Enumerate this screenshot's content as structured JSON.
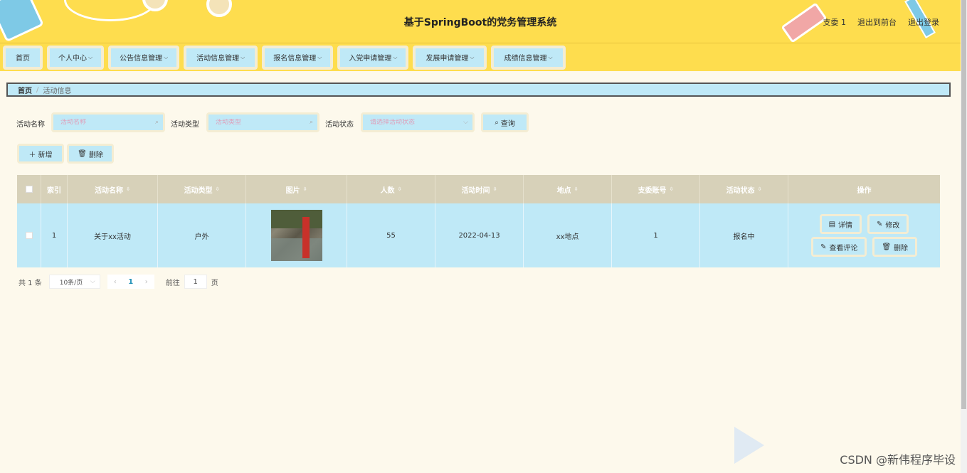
{
  "header": {
    "title": "基于SpringBoot的党务管理系统",
    "user": "支委 1",
    "exit_front": "退出到前台",
    "logout": "退出登录"
  },
  "nav": {
    "items": [
      {
        "label": "首页",
        "has_dropdown": false
      },
      {
        "label": "个人中心",
        "has_dropdown": true
      },
      {
        "label": "公告信息管理",
        "has_dropdown": true
      },
      {
        "label": "活动信息管理",
        "has_dropdown": true
      },
      {
        "label": "报名信息管理",
        "has_dropdown": true
      },
      {
        "label": "入党申请管理",
        "has_dropdown": true
      },
      {
        "label": "发展申请管理",
        "has_dropdown": true
      },
      {
        "label": "成绩信息管理",
        "has_dropdown": true
      }
    ]
  },
  "breadcrumb": {
    "home": "首页",
    "sep": "/",
    "current": "活动信息"
  },
  "search": {
    "name_label": "活动名称",
    "name_placeholder": "活动名称",
    "type_label": "活动类型",
    "type_placeholder": "活动类型",
    "status_label": "活动状态",
    "status_placeholder": "请选择活动状态",
    "query_label": "查询"
  },
  "actions": {
    "add_label": "新增",
    "delete_label": "删除"
  },
  "table": {
    "headers": {
      "index": "索引",
      "name": "活动名称",
      "type": "活动类型",
      "image": "图片",
      "count": "人数",
      "time": "活动时间",
      "place": "地点",
      "account": "支委账号",
      "status": "活动状态",
      "ops": "操作"
    },
    "rows": [
      {
        "index": "1",
        "name": "关于xx活动",
        "type": "户外",
        "count": "55",
        "time": "2022-04-13",
        "place": "xx地点",
        "account": "1",
        "status": "报名中",
        "ops": {
          "detail": "详情",
          "edit": "修改",
          "comments": "查看评论",
          "delete": "删除"
        }
      }
    ]
  },
  "pager": {
    "total": "共 1 条",
    "page_size": "10条/页",
    "current": "1",
    "goto_prefix": "前往",
    "goto_value": "1",
    "goto_suffix": "页"
  },
  "watermark": "CSDN @新伟程序毕设"
}
